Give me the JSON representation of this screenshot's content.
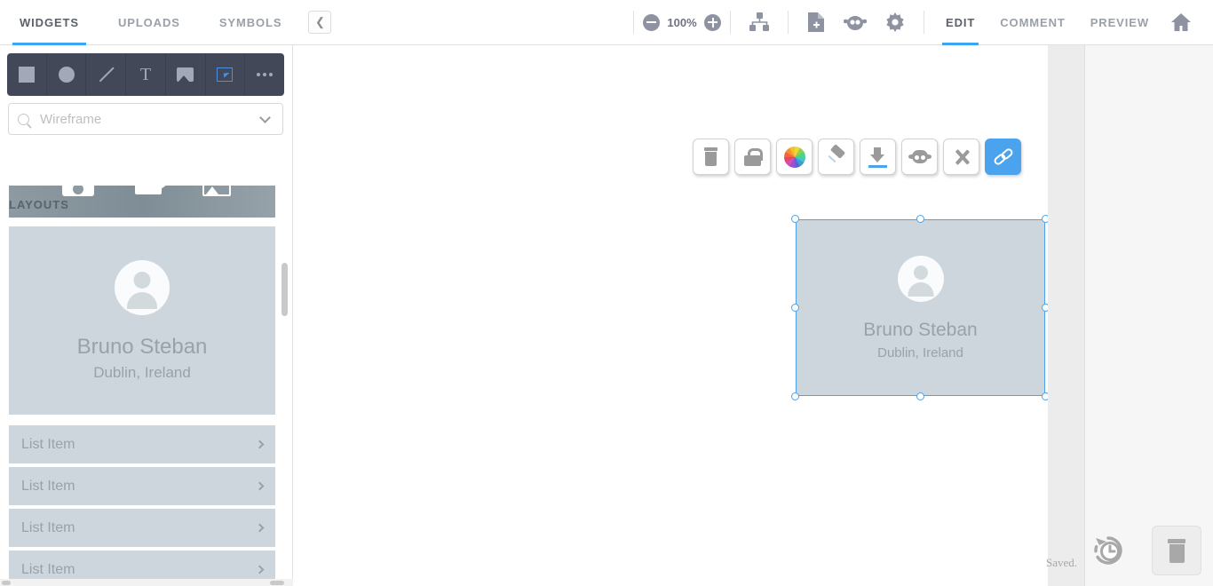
{
  "topbar": {
    "left_tabs": [
      {
        "label": "WIDGETS",
        "active": true
      },
      {
        "label": "UPLOADS",
        "active": false
      },
      {
        "label": "SYMBOLS",
        "active": false
      }
    ],
    "collapse_icon": "chevron-left-icon",
    "zoom": {
      "out_icon": "zoom-out-icon",
      "value": "100%",
      "in_icon": "zoom-in-icon"
    },
    "icons": [
      "sitemap-icon",
      "add-page-icon",
      "mascot-icon",
      "gear-icon"
    ],
    "right_tabs": [
      {
        "label": "EDIT",
        "active": true
      },
      {
        "label": "COMMENT",
        "active": false
      },
      {
        "label": "PREVIEW",
        "active": false
      }
    ],
    "home_icon": "home-icon"
  },
  "sidebar": {
    "palette": [
      {
        "name": "rectangle-tool",
        "icon": "square-icon"
      },
      {
        "name": "ellipse-tool",
        "icon": "circle-icon"
      },
      {
        "name": "line-tool",
        "icon": "line-icon"
      },
      {
        "name": "text-tool",
        "icon": "text-t-icon"
      },
      {
        "name": "image-tool",
        "icon": "image-icon"
      },
      {
        "name": "select-tool",
        "icon": "selection-cursor-icon"
      },
      {
        "name": "more-tools",
        "icon": "ellipsis-icon"
      }
    ],
    "search": {
      "placeholder": "Wireframe",
      "value": "",
      "search_icon": "search-icon",
      "dropdown_icon": "chevron-down-icon"
    },
    "thumbnail_strip": [
      "camera-icon",
      "video-icon",
      "photos-icon"
    ],
    "section_label": "LAYOUTS",
    "profile_card": {
      "avatar_icon": "person-avatar-icon",
      "name": "Bruno Steban",
      "location": "Dublin, Ireland"
    },
    "list_items": [
      {
        "label": "List Item",
        "chevron": "chevron-right-icon"
      },
      {
        "label": "List Item",
        "chevron": "chevron-right-icon"
      },
      {
        "label": "List Item",
        "chevron": "chevron-right-icon"
      },
      {
        "label": "List Item",
        "chevron": "chevron-right-icon"
      }
    ]
  },
  "element_toolbar": [
    {
      "name": "delete-element-button",
      "icon": "trash-icon",
      "active": false
    },
    {
      "name": "lock-element-button",
      "icon": "lock-icon",
      "active": false
    },
    {
      "name": "color-picker-button",
      "icon": "color-wheel-icon",
      "active": false
    },
    {
      "name": "pin-element-button",
      "icon": "pushpin-icon",
      "active": false
    },
    {
      "name": "download-element-button",
      "icon": "download-icon",
      "active": false
    },
    {
      "name": "mascot-button",
      "icon": "sheep-face-icon",
      "active": false
    },
    {
      "name": "tools-button",
      "icon": "hammer-wrench-icon",
      "active": false
    },
    {
      "name": "link-button",
      "icon": "link-chain-icon",
      "active": true
    }
  ],
  "canvas": {
    "selected_element": {
      "avatar_icon": "person-avatar-icon",
      "name": "Bruno Steban",
      "location": "Dublin, Ireland",
      "selected": true,
      "handle_count": 8,
      "selection_color": "#4aa3ec"
    }
  },
  "footer": {
    "saved_status": "Saved.",
    "history_icon": "history-clock-icon",
    "trash_icon": "trash-icon"
  },
  "colors": {
    "accent_blue": "#3ba4f3",
    "toolbar_blue": "#4aa3ec",
    "palette_dark": "#434859",
    "card_gray": "#cdd6dd",
    "text_muted": "#9aa2a8"
  }
}
